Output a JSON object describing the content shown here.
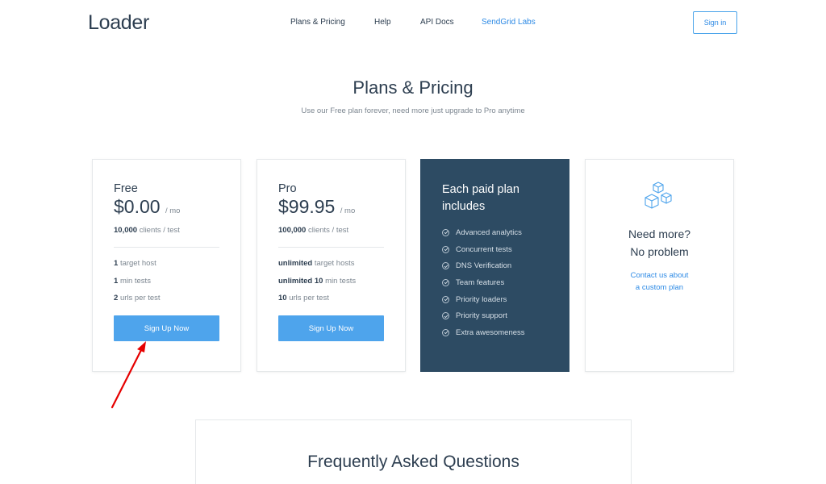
{
  "header": {
    "logo": "Loader",
    "nav": [
      {
        "label": "Plans & Pricing"
      },
      {
        "label": "Help"
      },
      {
        "label": "API Docs"
      },
      {
        "label": "SendGrid Labs"
      }
    ],
    "signin_label": "Sign in"
  },
  "hero": {
    "title": "Plans & Pricing",
    "subtitle": "Use our Free plan forever, need more just upgrade to Pro anytime"
  },
  "plans": {
    "free": {
      "name": "Free",
      "price": "$0.00",
      "unit": "/ mo",
      "clients_value": "10,000",
      "clients_suffix": "clients / test",
      "features": [
        {
          "bold": "1",
          "text": "target host"
        },
        {
          "bold": "1",
          "text": "min tests"
        },
        {
          "bold": "2",
          "text": "urls per test"
        }
      ],
      "cta": "Sign Up Now"
    },
    "pro": {
      "name": "Pro",
      "price": "$99.95",
      "unit": "/ mo",
      "clients_value": "100,000",
      "clients_suffix": "clients / test",
      "features": [
        {
          "bold": "unlimited",
          "text": "target hosts"
        },
        {
          "bold": "unlimited 10",
          "text": "min tests"
        },
        {
          "bold": "10",
          "text": "urls per test"
        }
      ],
      "cta": "Sign Up Now"
    },
    "paid": {
      "title": "Each paid plan includes",
      "items": [
        "Advanced analytics",
        "Concurrent tests",
        "DNS Verification",
        "Team features",
        "Priority loaders",
        "Priority support",
        "Extra awesomeness"
      ]
    },
    "more": {
      "title_line1": "Need more?",
      "title_line2": "No problem",
      "link_line1": "Contact us about",
      "link_line2": "a custom plan",
      "icon": "boxes-icon"
    }
  },
  "faq": {
    "title": "Frequently Asked Questions"
  },
  "colors": {
    "brand": "#2d3e50",
    "accent": "#4ea4ec",
    "link": "#2d8ae5",
    "paid_bg": "#2d4b63",
    "annotation": "#e60000"
  }
}
